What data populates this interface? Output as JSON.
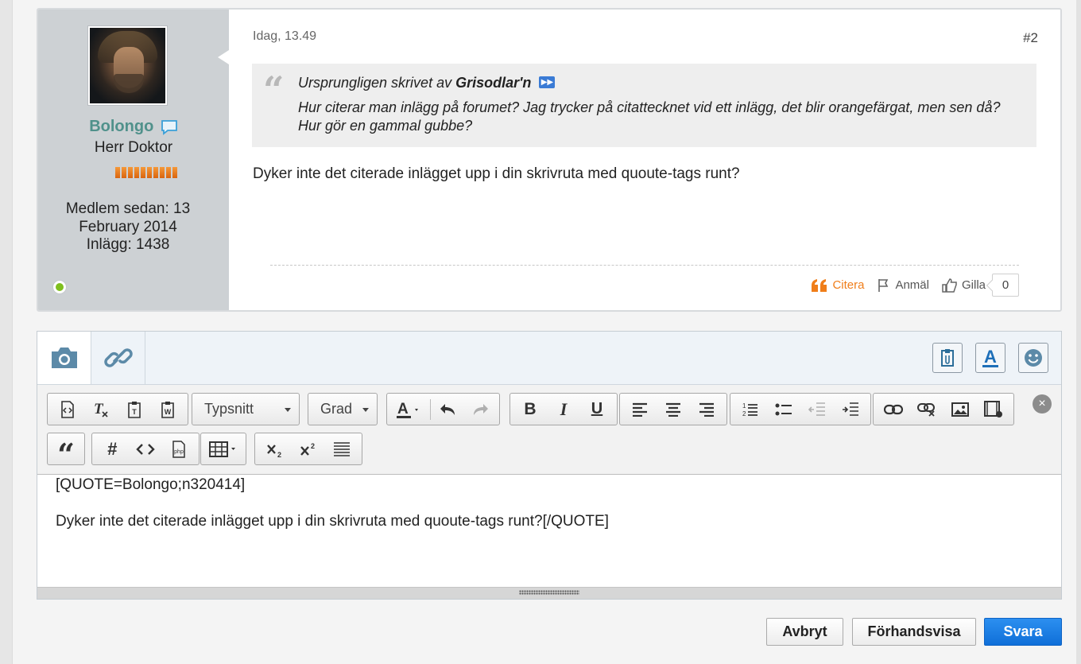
{
  "post": {
    "date": "Idag, 13.49",
    "number": "#2",
    "user": {
      "name": "Bolongo",
      "title": "Herr Doktor",
      "reputation_level": 10,
      "stats_line1": "Medlem sedan: 13",
      "stats_line2": "February 2014",
      "stats_line3": "Inlägg: 1438",
      "status": "online",
      "status_color": "#7fbf1e",
      "name_color": "#50918b"
    },
    "quote": {
      "prefix": "Ursprungligen skrivet av",
      "author": "Grisodlar'n",
      "text": "Hur citerar man inlägg på forumet? Jag trycker på citattecknet vid ett inlägg, det blir orangefärgat, men sen då? Hur gör en gammal gubbe?"
    },
    "body": "Dyker inte det citerade inlägget upp i din skrivruta med quoute-tags runt?",
    "actions": {
      "quote": "Citera",
      "report": "Anmäl",
      "like": "Gilla",
      "like_count": "0",
      "quote_color": "#f07e1a"
    }
  },
  "editor": {
    "tabs": [
      "camera-icon",
      "link-icon"
    ],
    "font_select": "Typsnitt",
    "size_select": "Grad",
    "content_line1": "[QUOTE=Bolongo;n320414]",
    "content_line2": "Dyker inte det citerade inlägget upp i din skrivruta med quoute-tags runt?[/QUOTE]"
  },
  "buttons": {
    "cancel": "Avbryt",
    "preview": "Förhandsvisa",
    "submit": "Svara",
    "submit_color": "#1a7fe6"
  }
}
